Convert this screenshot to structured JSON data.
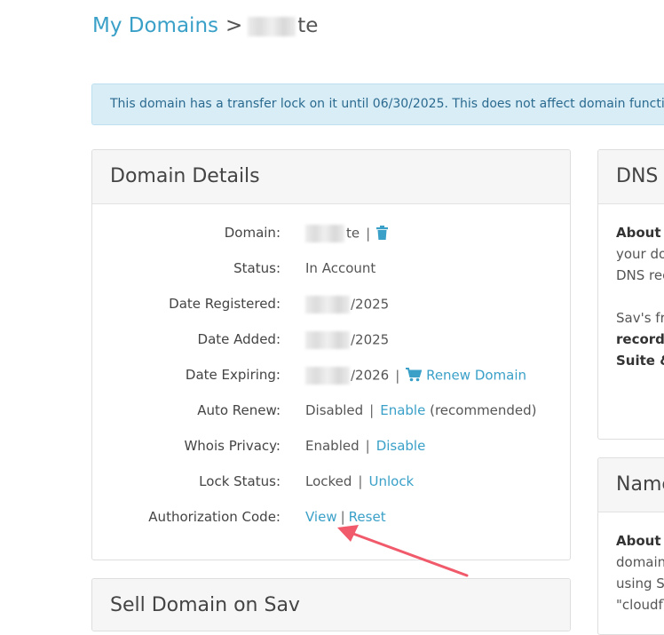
{
  "breadcrumb": {
    "root": "My Domains",
    "separator": ">",
    "current_suffix": "te"
  },
  "alert": {
    "text": "This domain has a transfer lock on it until 06/30/2025. This does not affect domain functionality"
  },
  "details": {
    "title": "Domain Details",
    "domain": {
      "label": "Domain:",
      "value_suffix": "te",
      "delete_icon": "trash-icon"
    },
    "status": {
      "label": "Status:",
      "value": "In Account"
    },
    "registered": {
      "label": "Date Registered:",
      "value_suffix": "/2025"
    },
    "added": {
      "label": "Date Added:",
      "value_suffix": "/2025"
    },
    "expiring": {
      "label": "Date Expiring:",
      "value_suffix": "/2026",
      "renew_label": "Renew Domain",
      "renew_icon": "cart-icon"
    },
    "auto_renew": {
      "label": "Auto Renew:",
      "value": "Disabled",
      "action": "Enable",
      "note": "(recommended)"
    },
    "whois": {
      "label": "Whois Privacy:",
      "value": "Enabled",
      "action": "Disable"
    },
    "lock": {
      "label": "Lock Status:",
      "value": "Locked",
      "action": "Unlock"
    },
    "auth": {
      "label": "Authorization Code:",
      "view": "View",
      "reset": "Reset"
    }
  },
  "sell": {
    "title": "Sell Domain on Sav"
  },
  "dns": {
    "title": "DNS",
    "lines": [
      "About D",
      "your do",
      "DNS rec",
      "",
      "Sav's fr",
      "records",
      "Suite &"
    ]
  },
  "names": {
    "title": "Name",
    "lines": [
      "About N",
      "domain",
      "using S",
      "\"cloudfl"
    ]
  },
  "colors": {
    "link": "#3aa0c8",
    "alert_bg": "#d9edf7",
    "arrow": "#f05a6a"
  }
}
